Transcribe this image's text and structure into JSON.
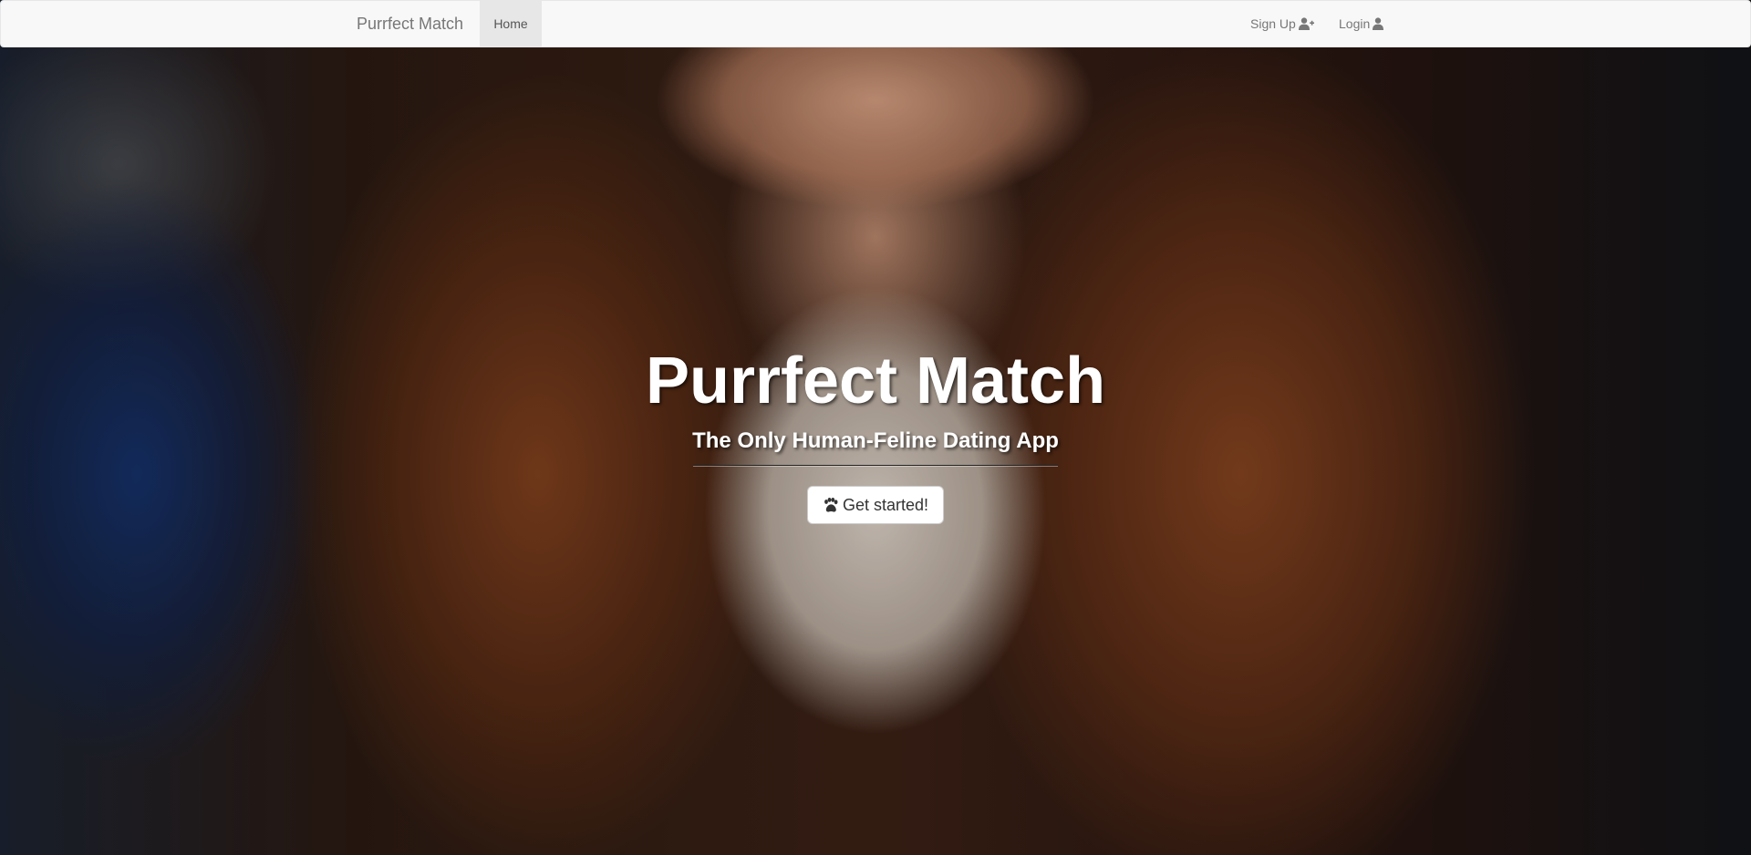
{
  "navbar": {
    "brand": "Purrfect Match",
    "home_label": "Home",
    "signup_label": "Sign Up",
    "login_label": "Login",
    "icons": {
      "signup": "user-plus-icon",
      "login": "user-icon"
    }
  },
  "hero": {
    "title": "Purrfect Match",
    "subtitle": "The Only Human-Feline Dating App",
    "cta_label": "Get started!",
    "cta_icon": "paw-icon"
  },
  "colors": {
    "navbar_bg": "#f8f8f8",
    "nav_text": "#777777",
    "hero_text": "#ffffff",
    "button_bg": "#ffffff"
  }
}
